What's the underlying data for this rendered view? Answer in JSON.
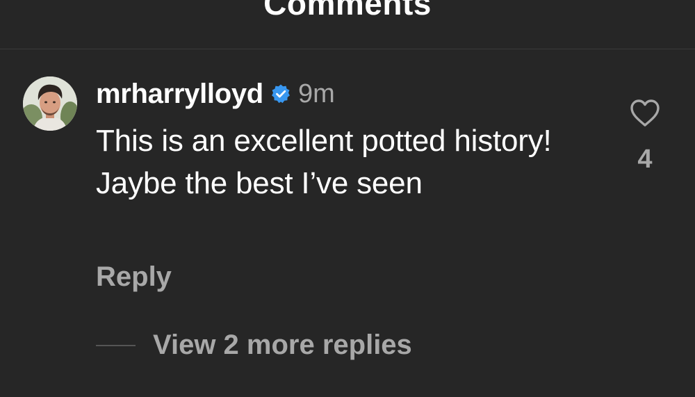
{
  "header": {
    "title": "Comments"
  },
  "comment": {
    "avatar_icon": "user-avatar",
    "username": "mrharrylloyd",
    "verified_icon": "verified-badge-icon",
    "verified_color": "#3897f0",
    "timestamp": "9m",
    "text": "This is an excellent potted history! Jaybe the best I’ve seen",
    "reply_label": "Reply",
    "like_icon": "heart-outline-icon",
    "like_count": "4",
    "view_replies_label": "View 2 more replies"
  },
  "colors": {
    "background": "#262626",
    "primary_text": "#ffffff",
    "secondary_text": "#a8a8a8"
  }
}
